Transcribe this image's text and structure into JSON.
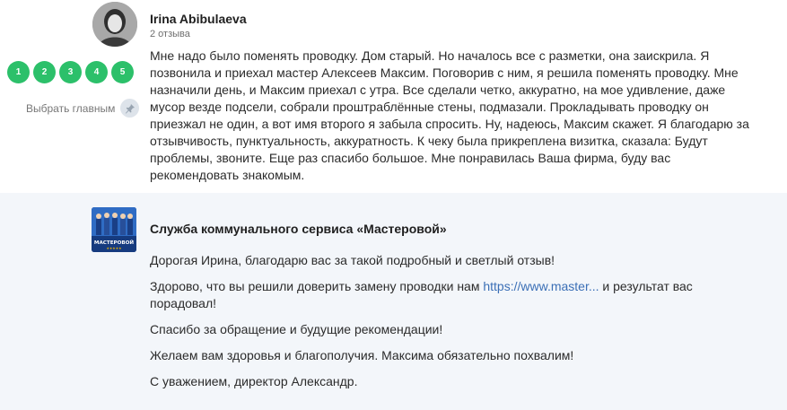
{
  "review": {
    "author": "Irina Abibulaeva",
    "count": "2 отзыва",
    "ratings": [
      "1",
      "2",
      "3",
      "4",
      "5"
    ],
    "pin_label": "Выбрать главным",
    "icons": {
      "pin": "pin-icon",
      "avatar": "user-photo"
    },
    "text": "Мне надо было поменять проводку. Дом старый. Но началось все с разметки, она заискрила. Я позвонила и приехал мастер Алексеев Максим. Поговорив с ним, я решила поменять проводку. Мне назначили день, и Максим приехал с утра. Все сделали четко, аккуратно, на мое удивление, даже мусор везде подсели, собрали проштраблённые стены, подмазали. Прокладывать проводку он приезжал не один, а вот имя второго я забыла спросить. Ну, надеюсь, Максим скажет. Я благодарю за отзывчивость, пунктуальность, аккуратность. К чеку была прикреплена визитка, сказала: Будут проблемы, звоните. Еще раз спасибо большое. Мне понравилась Ваша фирма, буду вас рекомендовать знакомым."
  },
  "reply": {
    "company": "Служба коммунального сервиса «Мастеровой»",
    "logo_text": "МАСТЕРОВОЙ",
    "p1": "Дорогая Ирина, благодарю вас за такой подробный и светлый отзыв!",
    "p2_before": "Здорово, что вы решили доверить замену проводки нам",
    "p2_link": "https://www.master...",
    "p2_after": "и результат вас порадовал!",
    "p3": "Спасибо за обращение и будущие рекомендации!",
    "p4": "Желаем вам здоровья и благополучия. Максима обязательно похвалим!",
    "p5": "С уважением, директор Александр."
  },
  "colors": {
    "rating_green": "#2cc06a",
    "reply_bg": "#f3f6fa",
    "link": "#3b6fb6"
  }
}
